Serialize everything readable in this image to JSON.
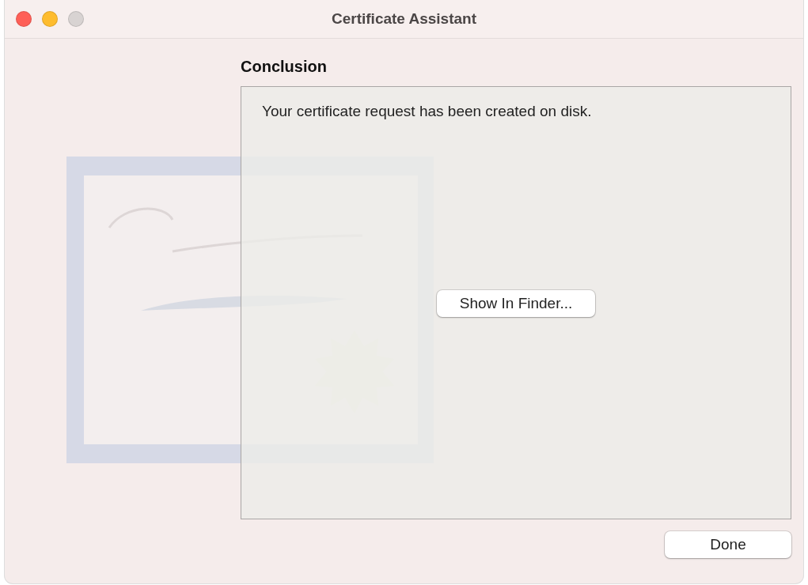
{
  "window": {
    "title": "Certificate Assistant"
  },
  "heading": "Conclusion",
  "message": "Your certificate request has been created on disk.",
  "panel_button": "Show In Finder...",
  "footer_button": "Done"
}
